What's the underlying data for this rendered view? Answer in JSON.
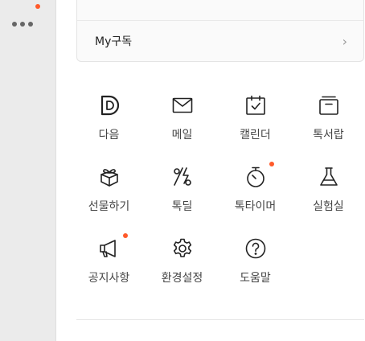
{
  "sidebar": {
    "more_icon": "more-horizontal-icon",
    "has_notification": true
  },
  "subscription": {
    "label": "My구독",
    "chevron": "›"
  },
  "apps": [
    {
      "id": "daum",
      "label": "다음",
      "icon": "daum-logo-icon",
      "badge": false
    },
    {
      "id": "mail",
      "label": "메일",
      "icon": "mail-icon",
      "badge": false
    },
    {
      "id": "calendar",
      "label": "캘린더",
      "icon": "calendar-icon",
      "badge": false
    },
    {
      "id": "drawer",
      "label": "톡서랍",
      "icon": "drawer-icon",
      "badge": false
    },
    {
      "id": "gift",
      "label": "선물하기",
      "icon": "gift-icon",
      "badge": false
    },
    {
      "id": "deal",
      "label": "톡딜",
      "icon": "percent-bolt-icon",
      "badge": false
    },
    {
      "id": "timer",
      "label": "톡타이머",
      "icon": "timer-icon",
      "badge": true
    },
    {
      "id": "lab",
      "label": "실험실",
      "icon": "flask-icon",
      "badge": false
    },
    {
      "id": "notice",
      "label": "공지사항",
      "icon": "megaphone-icon",
      "badge": true
    },
    {
      "id": "settings",
      "label": "환경설정",
      "icon": "gear-icon",
      "badge": false
    },
    {
      "id": "help",
      "label": "도움말",
      "icon": "help-icon",
      "badge": false
    }
  ],
  "colors": {
    "badge": "#ff5a2a",
    "rail": "#ebebeb"
  }
}
